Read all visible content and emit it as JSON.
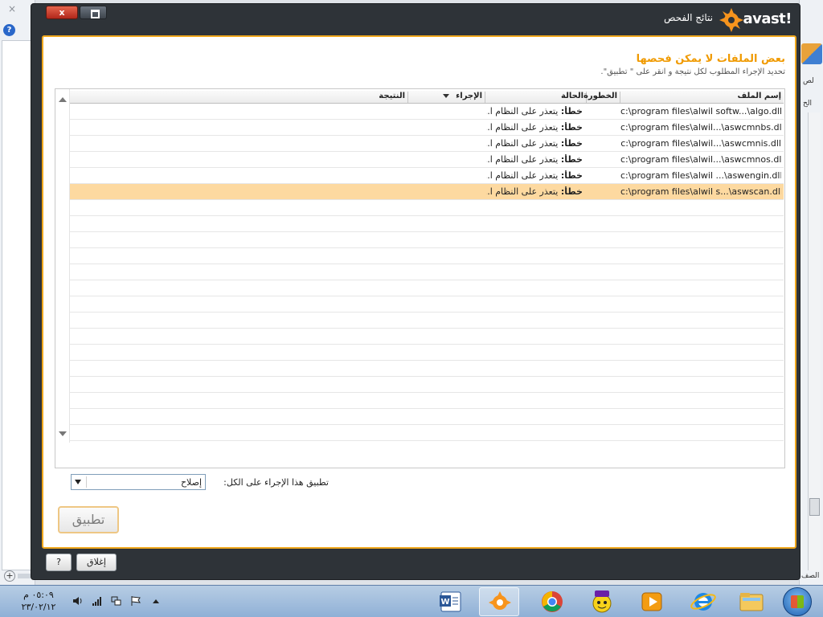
{
  "window": {
    "title": "نتائج الفحص",
    "logo_text": "avast!",
    "close_symbol": "x"
  },
  "content": {
    "heading": "بعض الملفات لا يمكن فحصها",
    "subheading": "تحديد الإجراء المطلوب لكل نتيجة و انقر على \" تطبيق\"."
  },
  "grid": {
    "columns": {
      "file_name": "إسم الملف",
      "severity": "الخطورة",
      "status": "الحالة",
      "action": "الإجراء",
      "result": "النتيجة"
    },
    "rows": [
      {
        "file": "c:\\program files\\alwil softw...\\algo.dll",
        "status_prefix": "خطأ:",
        "status_text": "يتعذر على النظام ا...",
        "selected": false
      },
      {
        "file": "c:\\program files\\alwil...\\aswcmnbs.dll",
        "status_prefix": "خطأ:",
        "status_text": "يتعذر على النظام ا...",
        "selected": false
      },
      {
        "file": "c:\\program files\\alwil...\\aswcmnis.dll",
        "status_prefix": "خطأ:",
        "status_text": "يتعذر على النظام ا...",
        "selected": false
      },
      {
        "file": "c:\\program files\\alwil...\\aswcmnos.dll",
        "status_prefix": "خطأ:",
        "status_text": "يتعذر على النظام ا...",
        "selected": false
      },
      {
        "file": "c:\\program files\\alwil ...\\aswengin.dll",
        "status_prefix": "خطأ:",
        "status_text": "يتعذر على النظام ا...",
        "selected": false
      },
      {
        "file": "c:\\program files\\alwil s...\\aswscan.dll",
        "status_prefix": "خطأ:",
        "status_text": "يتعذر على النظام ا...",
        "selected": true
      }
    ]
  },
  "apply_all": {
    "label": "تطبيق هذا الإجراء على الكل:",
    "selected_value": "إصلاح"
  },
  "buttons": {
    "apply": "تطبيق",
    "close": "إغلاق",
    "help": "?"
  },
  "taskbar": {
    "time": "٠٥:٠٩ م",
    "date": "٢٣/٠٢/١٢"
  },
  "background": {
    "close_symbol": "×",
    "help_symbol": "?",
    "plus_symbol": "+",
    "side_text_1": "لص",
    "side_text_2": "الح",
    "side_text_3": "الصف"
  },
  "colors": {
    "accent": "#f0a81d",
    "heading": "#f09a00",
    "selected_row": "#fdd9a0",
    "window_frame": "#2e3338"
  }
}
